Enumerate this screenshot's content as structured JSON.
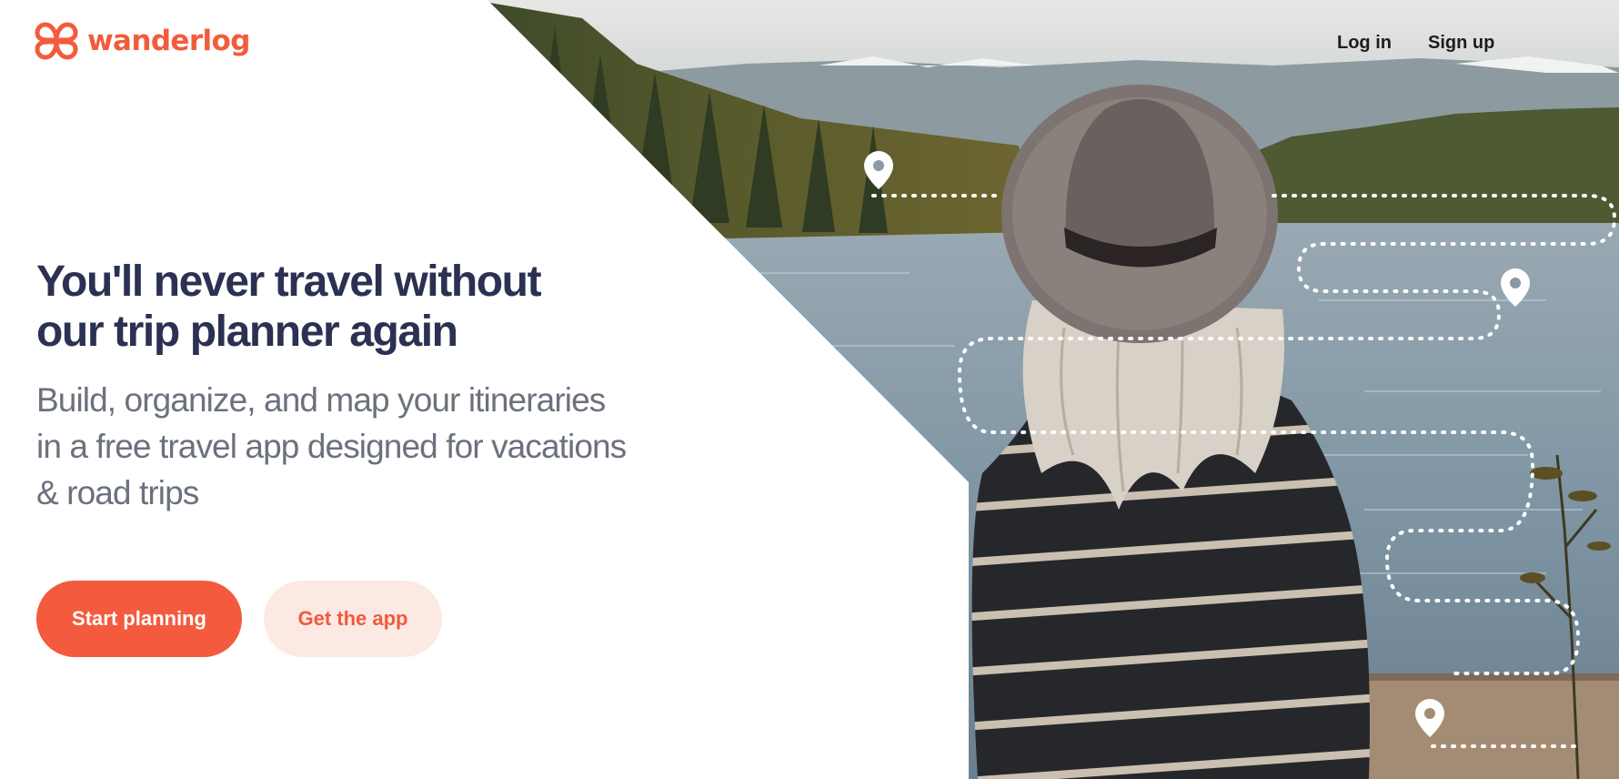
{
  "brand": {
    "name": "wanderlog",
    "accent_color": "#f25c3c",
    "logo_icon": "wanderlog-logo-icon"
  },
  "header": {
    "nav": [
      {
        "label": "Log in"
      },
      {
        "label": "Sign up"
      }
    ]
  },
  "hero": {
    "headline_lines": [
      "You'll never travel without",
      "our trip planner again"
    ],
    "subhead_lines": [
      "Build, organize, and map your itineraries",
      "in a free travel app designed for vacations",
      "& road trips"
    ],
    "primary_cta": "Start planning",
    "secondary_cta": "Get the app",
    "image": {
      "description_icon": "map-pin-icon",
      "pin_count": 3
    }
  },
  "colors": {
    "headline": "#2b3152",
    "subhead": "#6b717d",
    "primary_button": "#f45a3d",
    "secondary_button_bg": "#fde9e4"
  }
}
